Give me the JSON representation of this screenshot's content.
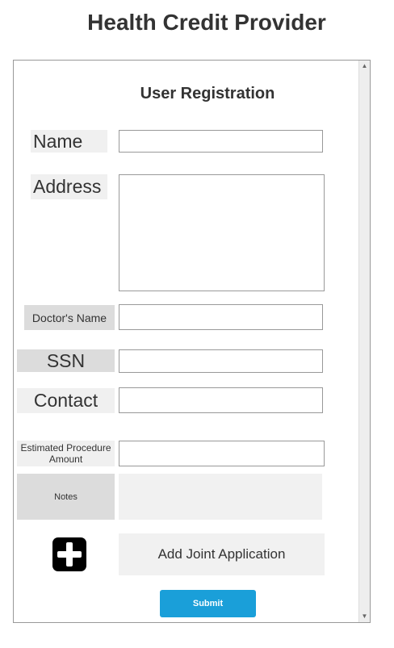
{
  "app": {
    "title": "Health Credit Provider"
  },
  "form": {
    "title": "User Registration",
    "fields": {
      "name": {
        "label": "Name",
        "value": ""
      },
      "address": {
        "label": "Address",
        "value": ""
      },
      "doctor_name": {
        "label": "Doctor's Name",
        "value": ""
      },
      "ssn": {
        "label": "SSN",
        "value": ""
      },
      "contact": {
        "label": "Contact",
        "value": ""
      },
      "procedure_amount": {
        "label_line1": "Estimated Procedure",
        "label_line2": "Amount",
        "value": ""
      },
      "notes": {
        "label": "Notes",
        "value": ""
      }
    },
    "joint_application": {
      "icon": "plus-icon",
      "label": "Add Joint Application"
    },
    "submit_label": "Submit"
  },
  "colors": {
    "accent": "#1a9fd9",
    "label_bg_light": "#f0f0f0",
    "label_bg_mid": "#dcdcdc",
    "panel_border": "#999999"
  }
}
